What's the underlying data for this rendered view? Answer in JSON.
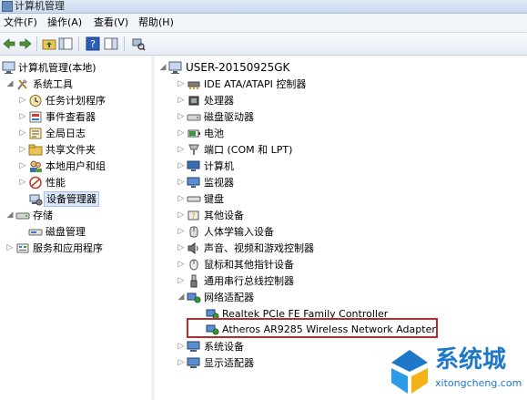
{
  "window": {
    "title": "计算机管理"
  },
  "menu": {
    "file": "文件(F)",
    "action": "操作(A)",
    "view": "查看(V)",
    "help": "帮助(H)"
  },
  "left_tree": {
    "root": "计算机管理(本地)",
    "system_tools": "系统工具",
    "task_scheduler": "任务计划程序",
    "event_viewer": "事件查看器",
    "global_log": "全局日志",
    "shared_folders": "共享文件夹",
    "local_users": "本地用户和组",
    "performance": "性能",
    "device_manager": "设备管理器",
    "storage": "存储",
    "disk_management": "磁盘管理",
    "services_apps": "服务和应用程序"
  },
  "device_tree": {
    "computer_name": "USER-20150925GK",
    "categories": [
      "IDE ATA/ATAPI 控制器",
      "处理器",
      "磁盘驱动器",
      "电池",
      "端口 (COM 和 LPT)",
      "计算机",
      "监视器",
      "键盘",
      "其他设备",
      "人体学输入设备",
      "声音、视频和游戏控制器",
      "鼠标和其他指针设备",
      "通用串行总线控制器",
      "网络适配器"
    ],
    "network_adapters": [
      "Realtek PCIe FE Family Controller",
      "Atheros AR9285 Wireless Network Adapter"
    ],
    "after": [
      "系统设备",
      "显示适配器"
    ]
  },
  "watermark": {
    "text": "系统城",
    "url": "xitongcheng.com"
  },
  "colors": {
    "highlight_border": "#c0282d",
    "watermark_blue": "#1e78c8",
    "selection_bg": "#dbe6f6"
  }
}
